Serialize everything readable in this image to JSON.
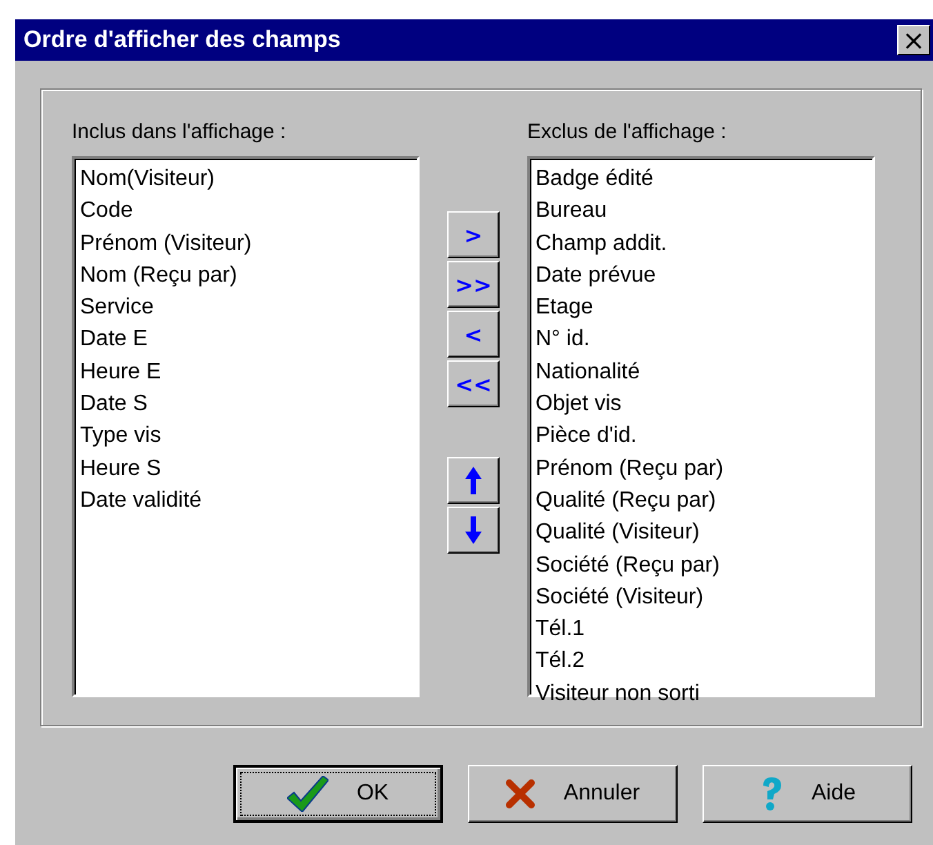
{
  "window": {
    "title": "Ordre d'afficher des champs",
    "close": "×"
  },
  "included": {
    "label": "Inclus dans l'affichage :",
    "items": [
      "Nom(Visiteur)",
      "Code",
      "Prénom (Visiteur)",
      "Nom (Reçu par)",
      "Service",
      "Date E",
      "Heure E",
      "Date S",
      "Type vis",
      "Heure S",
      "Date validité"
    ]
  },
  "excluded": {
    "label": "Exclus de l'affichage :",
    "items": [
      "Badge  édité",
      "Bureau",
      "Champ addit.",
      "Date prévue",
      "Etage",
      "N° id.",
      "Nationalité",
      "Objet vis",
      "Pièce d'id.",
      "Prénom (Reçu par)",
      "Qualité (Reçu par)",
      "Qualité (Visiteur)",
      "Société (Reçu par)",
      "Société (Visiteur)",
      "Tél.1",
      "Tél.2",
      "Visiteur non sorti"
    ]
  },
  "move_buttons": [
    {
      "kind": "text",
      "label": ">"
    },
    {
      "kind": "text",
      "label": ">>"
    },
    {
      "kind": "text",
      "label": "<"
    },
    {
      "kind": "text",
      "label": "<<"
    },
    {
      "kind": "up"
    },
    {
      "kind": "down"
    }
  ],
  "buttons": [
    {
      "kind": "ok",
      "label": "OK",
      "default": true
    },
    {
      "kind": "cancel",
      "label": "Annuler",
      "default": false
    },
    {
      "kind": "help",
      "label": "Aide",
      "default": false
    }
  ]
}
